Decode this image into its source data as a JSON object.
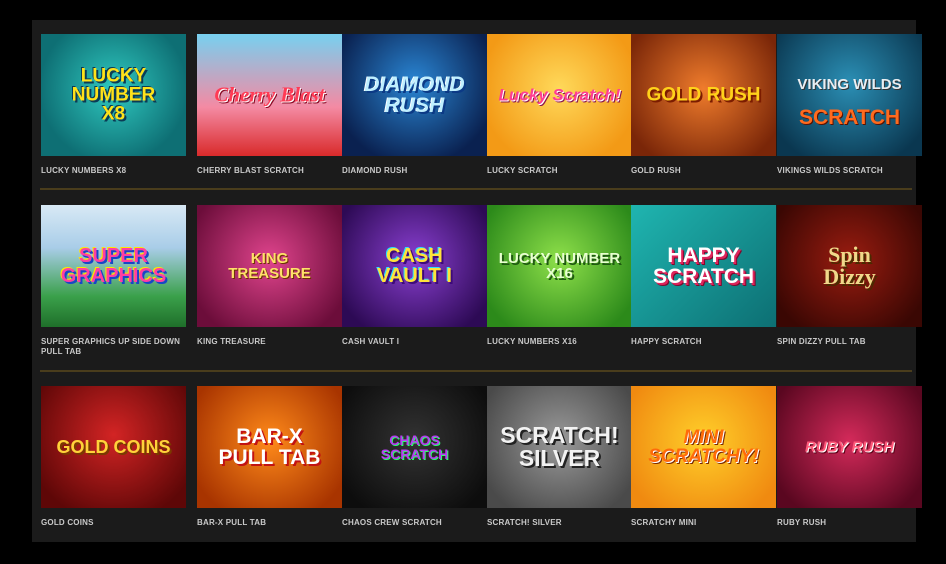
{
  "games": [
    {
      "title": "LUCKY NUMBERS X8",
      "logo": "LUCKY NUMBER\nX8"
    },
    {
      "title": "CHERRY BLAST SCRATCH",
      "logo": "Cherry Blast"
    },
    {
      "title": "DIAMOND RUSH",
      "logo": "DIAMOND\nRUSH"
    },
    {
      "title": "LUCKY SCRATCH",
      "logo": "Lucky Scratch!"
    },
    {
      "title": "GOLD RUSH",
      "logo": "GOLD RUSH"
    },
    {
      "title": "VIKINGS WILDS SCRATCH",
      "logo": "VIKING WILDS",
      "logo_sub": "SCRATCH"
    },
    {
      "title": "SUPER GRAPHICS UP SIDE DOWN PULL TAB",
      "logo": "SUPER\nGRAPHICS"
    },
    {
      "title": "KING TREASURE",
      "logo": "KING\nTREASURE"
    },
    {
      "title": "CASH VAULT I",
      "logo": "CASH\nVAULT I"
    },
    {
      "title": "LUCKY NUMBERS X16",
      "logo": "LUCKY NUMBER\nX16"
    },
    {
      "title": "HAPPY SCRATCH",
      "logo": "HAPPY\nSCRATCH"
    },
    {
      "title": "SPIN DIZZY PULL TAB",
      "logo": "Spin\nDizzy"
    },
    {
      "title": "GOLD COINS",
      "logo": "GOLD COINS"
    },
    {
      "title": "BAR-X PULL TAB",
      "logo": "BAR-X\nPULL TAB"
    },
    {
      "title": "CHAOS CREW SCRATCH",
      "logo": "CHAOS\nSCRATCH"
    },
    {
      "title": "SCRATCH! SILVER",
      "logo": "SCRATCH!\nSILVER"
    },
    {
      "title": "SCRATCHY MINI",
      "logo": "MINI\nSCRATCHY!"
    },
    {
      "title": "RUBY RUSH",
      "logo": "RUBY RUSH"
    }
  ]
}
